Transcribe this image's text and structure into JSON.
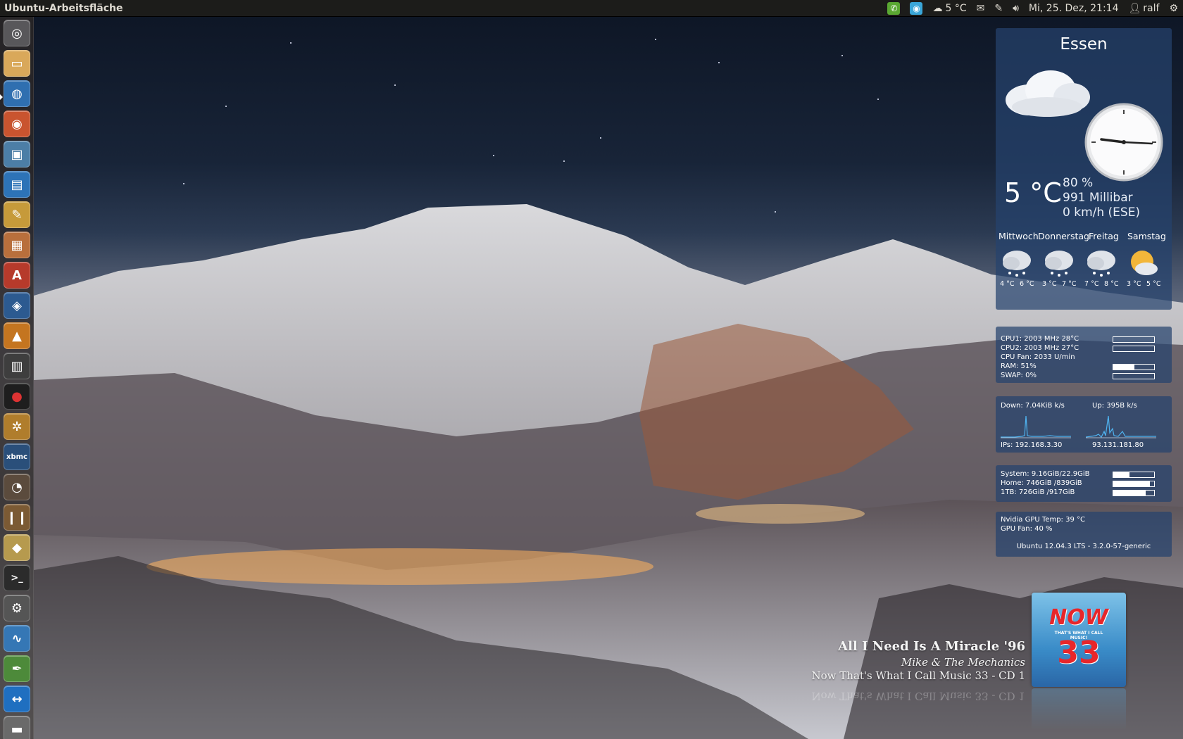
{
  "panel": {
    "title": "Ubuntu-Arbeitsfläche",
    "weather": "5 °C",
    "datetime": "Mi, 25. Dez, 21:14",
    "user": "ralf"
  },
  "launcher": {
    "items": [
      "dash-home",
      "files",
      "firefox",
      "chromium",
      "screenshot",
      "writer",
      "text-editor",
      "image-viewer",
      "pdf-viewer",
      "network-tool",
      "vlc",
      "video-editor",
      "record-tool",
      "pineapple-app",
      "xbmc",
      "sound-app",
      "library",
      "archive",
      "terminal",
      "settings-tool",
      "system-monitor",
      "tweak-tool",
      "teamviewer",
      "trash"
    ],
    "xbmc_label": "xbmc"
  },
  "weather": {
    "city": "Essen",
    "temp": "5 °C",
    "humidity": "80 %",
    "pressure": "991 Millibar",
    "wind": "0 km/h (ESE)",
    "clock_time": "21:14",
    "forecast": [
      {
        "day": "Mittwoch",
        "low": "4 °C",
        "high": "6 °C",
        "icon": "snow-cloud"
      },
      {
        "day": "Donnerstag",
        "low": "3 °C",
        "high": "7 °C",
        "icon": "snow-cloud"
      },
      {
        "day": "Freitag",
        "low": "7 °C",
        "high": "8 °C",
        "icon": "snow-cloud"
      },
      {
        "day": "Samstag",
        "low": "3 °C",
        "high": "5 °C",
        "icon": "sun-cloud"
      }
    ]
  },
  "system": {
    "cpu1": "CPU1: 2003 MHz 28°C",
    "cpu2": "CPU2: 2003 MHz 27°C",
    "cpu_fan": "CPU Fan:  2033 U/min",
    "ram": "RAM: 51%",
    "swap": "SWAP: 0%",
    "cpu1_load": 0.0,
    "cpu2_load": 0.0,
    "ram_load": 0.51,
    "swap_load": 0.0
  },
  "network": {
    "down": "Down: 7.04KiB k/s",
    "up": "Up: 395B   k/s",
    "ip_local": "IPs: 192.168.3.30",
    "ip_public": "93.131.181.80"
  },
  "disks": {
    "system": "System: 9.16GiB/22.9GiB",
    "home": "Home: 746GiB /839GiB",
    "tb": "1TB: 726GiB /917GiB",
    "system_use": 0.4,
    "home_use": 0.89,
    "tb_use": 0.79
  },
  "gpu": {
    "temp": "Nvidia GPU Temp:  39 °C",
    "fan": "GPU Fan:    40 %",
    "os": "Ubuntu 12.04.3 LTS - 3.2.0-57-generic"
  },
  "now_playing": {
    "title": "All I Need Is A Miracle '96",
    "artist": "Mike & The Mechanics",
    "album": "Now That's What I Call Music 33 - CD 1",
    "cover_text_1": "NOW",
    "cover_text_2": "33",
    "cover_tagline": "THAT'S WHAT I CALL MUSIC!"
  },
  "colors": {
    "panel_bg": "#1c1c1a",
    "desklet_bg": "#26426e",
    "skype_green": "#5aa832",
    "accent_cyan": "#3aa6d8"
  }
}
